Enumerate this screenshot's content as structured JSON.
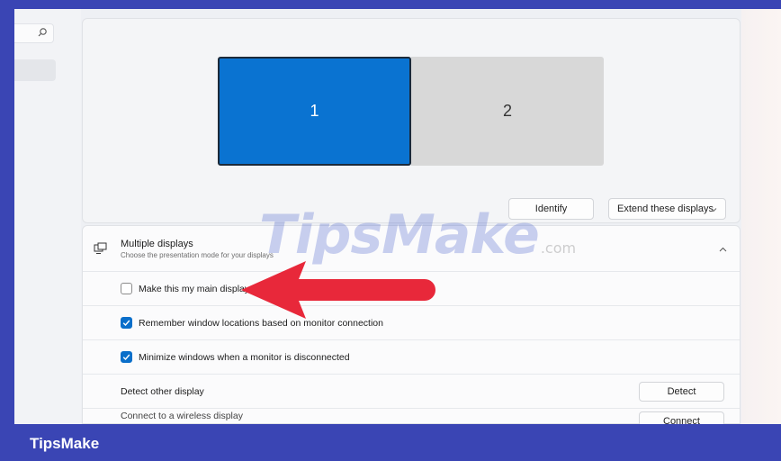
{
  "display_preview": {
    "monitors": [
      {
        "label": "1",
        "selected": true
      },
      {
        "label": "2",
        "selected": false
      }
    ],
    "identify_label": "Identify",
    "mode_select_value": "Extend these displays"
  },
  "multiple_displays": {
    "title": "Multiple displays",
    "subtitle": "Choose the presentation mode for your displays",
    "expanded": true,
    "options": [
      {
        "label": "Make this my main display",
        "checked": false
      },
      {
        "label": "Remember window locations based on monitor connection",
        "checked": true
      },
      {
        "label": "Minimize windows when a monitor is disconnected",
        "checked": true
      }
    ],
    "detect": {
      "label": "Detect other display",
      "button": "Detect"
    },
    "wireless": {
      "label": "Connect to a wireless display",
      "button": "Connect"
    }
  },
  "watermark": {
    "main": "TipsMake",
    "suffix": ".com"
  },
  "footer": {
    "brand": "TipsMake"
  },
  "colors": {
    "accent": "#0a73d1",
    "frame_border": "#3a45b4",
    "annotation_arrow": "#e8283a"
  },
  "icons": {
    "search": "search-icon",
    "displays": "multiple-displays-icon",
    "collapse": "chevron-up-icon",
    "dropdown": "chevron-down-icon",
    "check": "checkmark-icon"
  }
}
